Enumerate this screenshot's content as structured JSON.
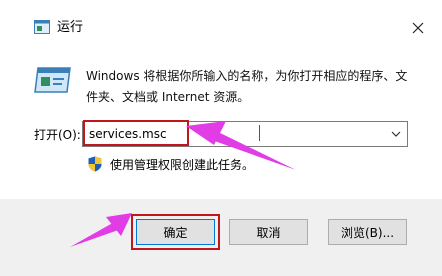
{
  "window": {
    "title": "运行",
    "close_icon": "close-icon",
    "title_icon": "run-icon"
  },
  "description": "Windows 将根据你所输入的名称，为你打开相应的程序、文件夹、文档或 Internet 资源。",
  "open_field": {
    "label": "打开(O):",
    "value": "services.msc"
  },
  "admin_note": "使用管理权限创建此任务。",
  "buttons": {
    "ok": "确定",
    "cancel": "取消",
    "browse": "浏览(B)..."
  },
  "colors": {
    "highlight": "#c0161e",
    "arrow": "#e23ce6",
    "accent": "#0078d7"
  }
}
